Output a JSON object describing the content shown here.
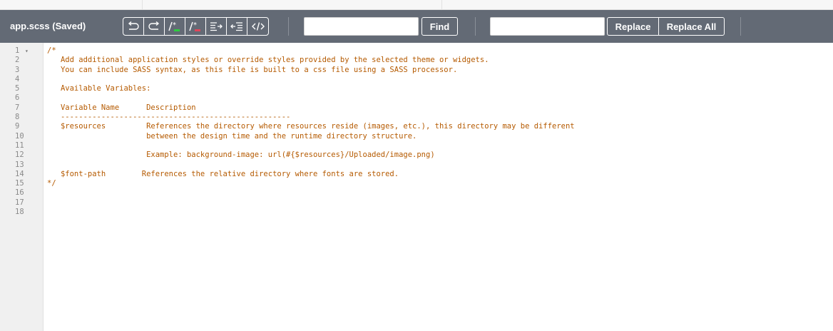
{
  "header": {
    "title": "app.scss (Saved)"
  },
  "toolbar": {
    "buttons": [
      {
        "name": "undo",
        "icon": "undo-icon"
      },
      {
        "name": "redo",
        "icon": "redo-icon"
      },
      {
        "name": "comment",
        "icon": "comment-add-icon"
      },
      {
        "name": "uncomment",
        "icon": "comment-remove-icon"
      },
      {
        "name": "indent",
        "icon": "indent-icon"
      },
      {
        "name": "outdent",
        "icon": "outdent-icon"
      },
      {
        "name": "format",
        "icon": "code-icon"
      }
    ],
    "find_value": "",
    "find_label": "Find",
    "replace_value": "",
    "replace_label": "Replace",
    "replace_all_label": "Replace All"
  },
  "editor": {
    "line_numbers": [
      "1",
      "2",
      "3",
      "4",
      "5",
      "6",
      "7",
      "8",
      "9",
      "10",
      "11",
      "12",
      "13",
      "14",
      "15",
      "16",
      "17",
      "18"
    ],
    "fold_marker": "▾",
    "lines": [
      "/*",
      "   Add additional application styles or override styles provided by the selected theme or widgets.",
      "   You can include SASS syntax, as this file is built to a css file using a SASS processor.",
      "",
      "   Available Variables:",
      "",
      "   Variable Name      Description",
      "   ---------------------------------------------------",
      "   $resources         References the directory where resources reside (images, etc.), this directory may be different",
      "                      between the design time and the runtime directory structure.",
      "",
      "                      Example: background-image: url(#{$resources}/Uploaded/image.png)",
      "",
      "   $font-path        References the relative directory where fonts are stored.",
      "*/",
      "",
      "",
      ""
    ]
  },
  "colors": {
    "toolbar_bg": "#636a75",
    "code_text": "#b55a00",
    "gutter_bg": "#f0f0f0"
  }
}
